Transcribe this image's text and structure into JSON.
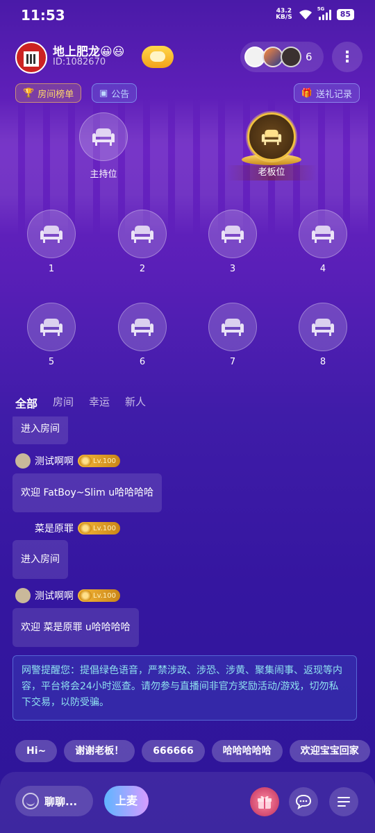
{
  "status": {
    "time": "11:53",
    "net_speed": "43.2",
    "net_unit": "KB/S",
    "signal_tag": "5G",
    "battery": "85"
  },
  "header": {
    "room_name": "地上肥龙😀😃",
    "room_id": "ID:1082670",
    "audience_count": "6"
  },
  "pills": {
    "rank": "房间榜单",
    "notice": "公告",
    "gift_log": "送礼记录"
  },
  "seats": {
    "host": "主持位",
    "boss": "老板位",
    "numbers": [
      "1",
      "2",
      "3",
      "4",
      "5",
      "6",
      "7",
      "8"
    ]
  },
  "tabs": [
    "全部",
    "房间",
    "幸运",
    "新人"
  ],
  "chat": {
    "msg0": "进入房间",
    "user1": "测试啊啊",
    "lv1": "Lv.100",
    "msg1": "欢迎 FatBoy~Slim u哈哈哈哈",
    "user2": "菜是原罪",
    "lv2": "Lv.100",
    "msg2": "进入房间",
    "user3": "测试啊啊",
    "lv3": "Lv.100",
    "msg3": "欢迎 菜是原罪 u哈哈哈哈",
    "notice": "网警提醒您：提倡绿色语音，严禁涉政、涉恐、涉黄、聚集闹事、返现等内容，平台将会24小时巡查。请勿参与直播间非官方奖励活动/游戏，切勿私下交易，以防受骗。"
  },
  "quick_replies": [
    "Hi~",
    "谢谢老板！",
    "666666",
    "哈哈哈哈哈",
    "欢迎宝宝回家"
  ],
  "bottom": {
    "input_placeholder": "聊聊...",
    "mic_label": "上麦"
  },
  "colors": {
    "accent_gold": "#f0c040",
    "notice_text": "#8fe2f0",
    "background_top": "#4a1aa8",
    "background_bottom": "#2d1598"
  }
}
